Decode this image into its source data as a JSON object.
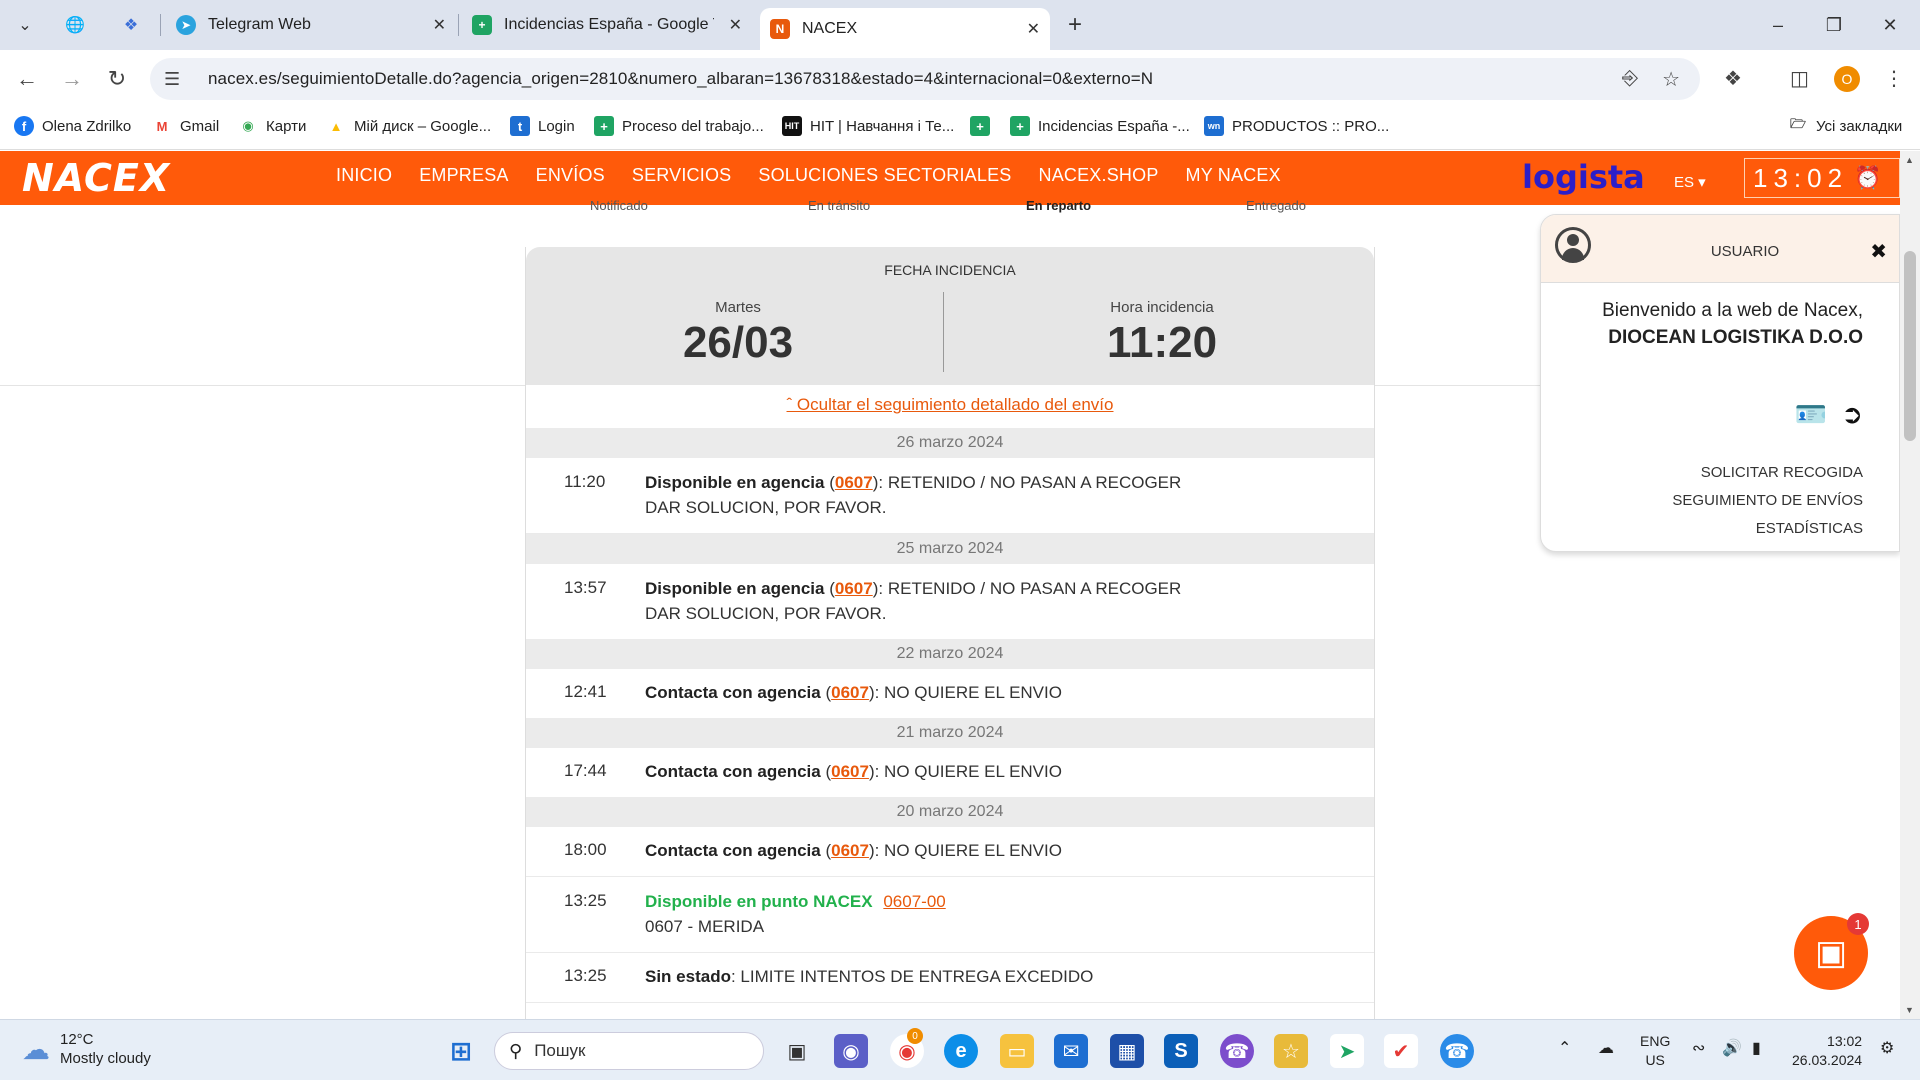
{
  "browser": {
    "tabs": [
      {
        "title": "Telegram Web",
        "icon": "telegram-icon"
      },
      {
        "title": "Incidencias España - Google Ta",
        "icon": "google-sheets-icon"
      },
      {
        "title": "NACEX",
        "icon": "nacex-icon"
      }
    ],
    "url": "nacex.es/seguimientoDetalle.do?agencia_origen=2810&numero_albaran=13678318&estado=4&internacional=0&externo=N",
    "profile_initial": "O",
    "bookmarks": [
      {
        "label": "Olena Zdrilko",
        "icon": "facebook-icon"
      },
      {
        "label": "Gmail",
        "icon": "gmail-icon"
      },
      {
        "label": "Карти",
        "icon": "maps-icon"
      },
      {
        "label": "Мій диск – Google...",
        "icon": "drive-icon"
      },
      {
        "label": "Login",
        "icon": "login-icon"
      },
      {
        "label": "Proceso del trabajo...",
        "icon": "sheets-icon"
      },
      {
        "label": "HIT | Навчання і Те...",
        "icon": "hit-icon"
      },
      {
        "label": "",
        "icon": "sheets-icon"
      },
      {
        "label": "Incidencias España -...",
        "icon": "sheets-icon"
      },
      {
        "label": "PRODUCTOS :: PRO...",
        "icon": "wn-icon"
      }
    ],
    "all_bookmarks": "Усі закладки"
  },
  "site": {
    "logo": "NACEX",
    "menu": [
      "INICIO",
      "EMPRESA",
      "ENVÍOS",
      "SERVICIOS",
      "SOLUCIONES SECTORIALES",
      "NACEX.SHOP",
      "MY NACEX"
    ],
    "partner": "logista",
    "lang": "ES",
    "clock": "13:02",
    "progress_steps": [
      "Notificado",
      "En tránsito",
      "En reparto",
      "Entregado"
    ]
  },
  "incident": {
    "header": "FECHA INCIDENCIA",
    "day_label": "Martes",
    "date": "26/03",
    "time_label": "Hora incidencia",
    "time": "11:20",
    "hide_link": "ˆ Ocultar el seguimiento detallado del envío"
  },
  "tracking": {
    "days": [
      {
        "date": "26 marzo 2024"
      },
      {
        "date": "25 marzo 2024"
      },
      {
        "date": "22 marzo 2024"
      },
      {
        "date": "21 marzo 2024"
      },
      {
        "date": "20 marzo 2024"
      }
    ],
    "events": [
      {
        "time": "11:20",
        "status": "Disponible en agencia",
        "code": "0607",
        "text": ": RETENIDO / NO PASAN A RECOGER DAR SOLUCION, POR FAVOR."
      },
      {
        "time": "13:57",
        "status": "Disponible en agencia",
        "code": "0607",
        "text": ": RETENIDO / NO PASAN A RECOGER DAR SOLUCION, POR FAVOR."
      },
      {
        "time": "12:41",
        "status": "Contacta con agencia",
        "code": "0607",
        "text": ": NO QUIERE EL ENVIO"
      },
      {
        "time": "17:44",
        "status": "Contacta con agencia",
        "code": "0607",
        "text": ": NO QUIERE EL ENVIO"
      },
      {
        "time": "18:00",
        "status": "Contacta con agencia",
        "code": "0607",
        "text": ": NO QUIERE EL ENVIO"
      },
      {
        "time": "13:25",
        "status": "Disponible en punto NACEX",
        "code": "0607-00",
        "text": "0607 - MERIDA"
      },
      {
        "time": "13:25",
        "status": "Sin estado",
        "code": "",
        "text": ": LIMITE INTENTOS DE ENTREGA EXCEDIDO"
      }
    ]
  },
  "user_popup": {
    "title": "USUARIO",
    "welcome": "Bienvenido a la web de Nacex,",
    "company": "DIOCEAN LOGISTIKA D.O.O",
    "links": [
      "SOLICITAR RECOGIDA",
      "SEGUIMIENTO DE ENVÍOS",
      "ESTADÍSTICAS"
    ]
  },
  "chat": {
    "badge": "1"
  },
  "taskbar": {
    "temp": "12°C",
    "weather": "Mostly cloudy",
    "search_placeholder": "Пошук",
    "chrome_badge": "0",
    "lang_top": "ENG",
    "lang_bottom": "US",
    "time": "13:02",
    "date": "26.03.2024"
  },
  "colors": {
    "brand": "#ff5a0a",
    "link": "#e8590c",
    "green": "#22b14c"
  }
}
